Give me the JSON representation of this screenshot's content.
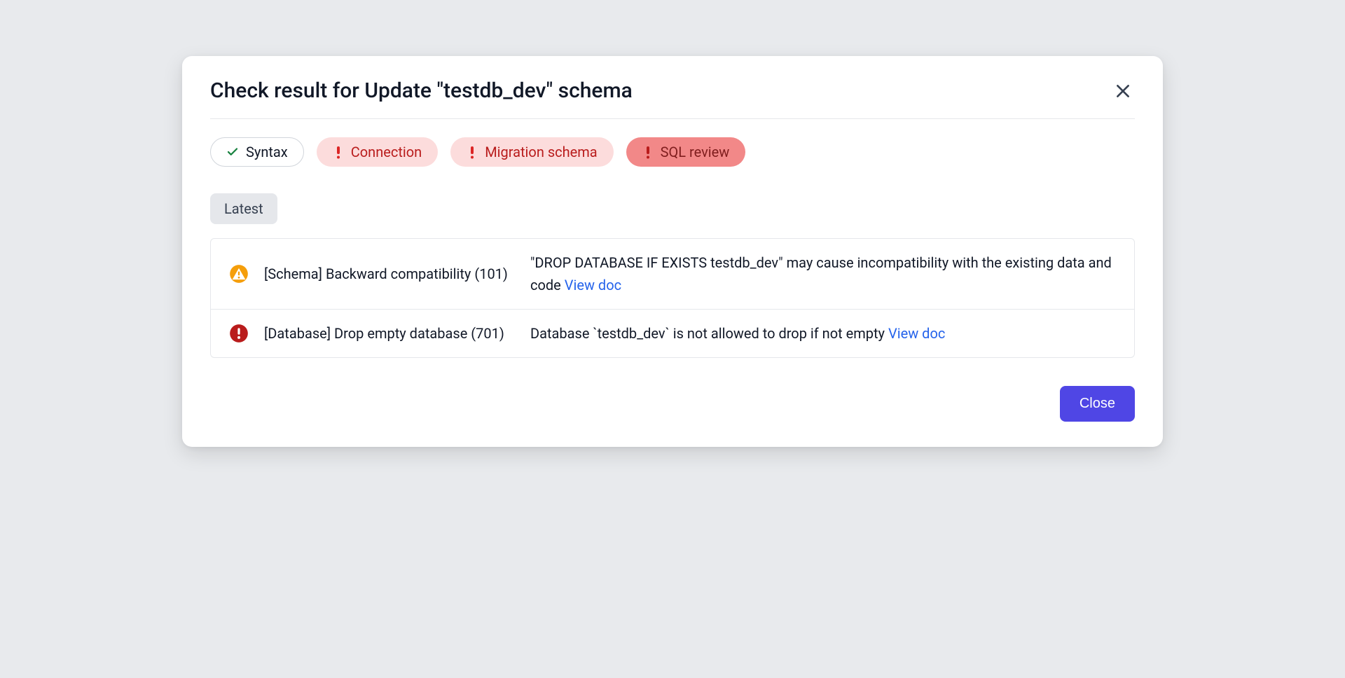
{
  "modal": {
    "title": "Check result for Update \"testdb_dev\" schema",
    "close_button": "Close"
  },
  "pills": [
    {
      "icon": "check",
      "label": "Syntax",
      "state": "ok"
    },
    {
      "icon": "exclaim",
      "label": "Connection",
      "state": "warn"
    },
    {
      "icon": "exclaim",
      "label": "Migration schema",
      "state": "warn"
    },
    {
      "icon": "exclaim",
      "label": "SQL review",
      "state": "error"
    }
  ],
  "sub_tab": "Latest",
  "results": [
    {
      "severity": "warning",
      "title": "[Schema] Backward compatibility (101)",
      "description": "\"DROP DATABASE IF EXISTS testdb_dev\" may cause incompatibility with the existing data and code ",
      "link_label": "View doc"
    },
    {
      "severity": "error",
      "title": "[Database] Drop empty database (701)",
      "description": "Database `testdb_dev` is not allowed to drop if not empty ",
      "link_label": "View doc"
    }
  ]
}
